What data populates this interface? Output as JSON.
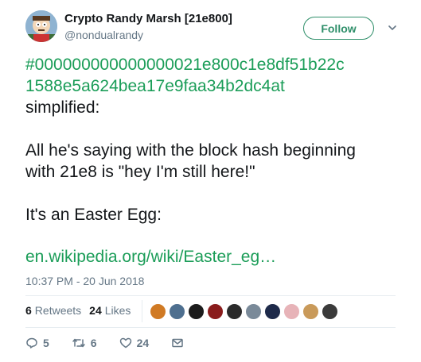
{
  "user": {
    "display_name": "Crypto Randy Marsh [21e800]",
    "handle": "@nondualrandy",
    "avatar_icon": "cartoon-avatar"
  },
  "follow_label": "Follow",
  "tweet": {
    "hash_line1": "#000000000000000021e800c1e8df51b22c",
    "hash_line2": "1588e5a624bea17e9faa34b2dc4at",
    "line_simplified": "simplified:",
    "line_saying_1": "All he's saying with the block hash beginning",
    "line_saying_2": "with 21e8 is \"hey I'm still here!\"",
    "line_egg": "It's an Easter Egg:",
    "link": "en.wikipedia.org/wiki/Easter_eg…",
    "timestamp": "10:37 PM - 20 Jun 2018"
  },
  "stats": {
    "retweets_count": "6",
    "retweets_label": "Retweets",
    "likes_count": "24",
    "likes_label": "Likes"
  },
  "liker_avatar_colors": [
    "#d07a24",
    "#4e6f8f",
    "#1c1c1c",
    "#8a1c1c",
    "#2b2b2b",
    "#7a8a99",
    "#1e2a4a",
    "#e7b3b8",
    "#c99a5a",
    "#3b3b3b"
  ],
  "actions": {
    "reply_count": "5",
    "retweet_count": "6",
    "like_count": "24"
  },
  "colors": {
    "accent": "#1b9d58",
    "follow_border": "#2f8f6a",
    "muted": "#657786"
  }
}
